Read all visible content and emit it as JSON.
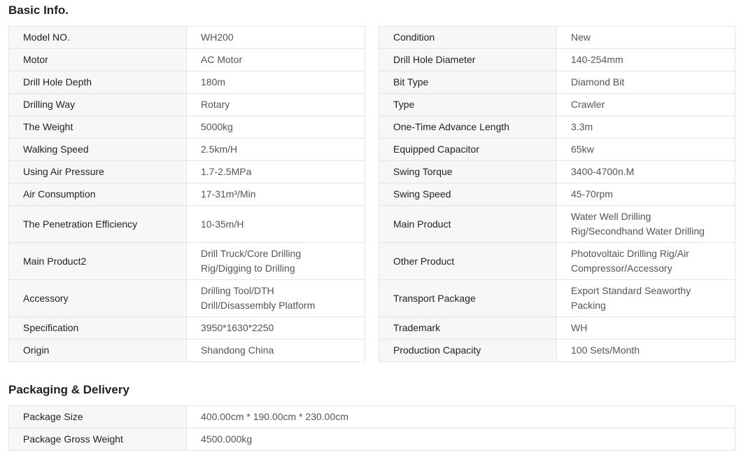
{
  "basic_info": {
    "title": "Basic Info.",
    "left": [
      {
        "label": "Model NO.",
        "value": "WH200",
        "lines": 1
      },
      {
        "label": "Motor",
        "value": "AC Motor",
        "lines": 1
      },
      {
        "label": "Drill Hole Depth",
        "value": "180m",
        "lines": 1
      },
      {
        "label": "Drilling Way",
        "value": "Rotary",
        "lines": 1
      },
      {
        "label": "The Weight",
        "value": "5000kg",
        "lines": 1
      },
      {
        "label": "Walking Speed",
        "value": "2.5km/H",
        "lines": 1
      },
      {
        "label": "Using Air Pressure",
        "value": "1.7-2.5MPa",
        "lines": 1
      },
      {
        "label": "Air Consumption",
        "value": "17-31m³/Min",
        "lines": 1
      },
      {
        "label": "The Penetration Efficiency",
        "value": "10-35m/H",
        "lines": 2
      },
      {
        "label": "Main Product2",
        "value": [
          "Drill Truck/Core Drilling",
          "Rig/Digging to Drilling"
        ],
        "lines": 2
      },
      {
        "label": "Accessory",
        "value": [
          "Drilling Tool/DTH",
          "Drill/Disassembly Platform"
        ],
        "lines": 2
      },
      {
        "label": "Specification",
        "value": "3950*1630*2250",
        "lines": 1
      },
      {
        "label": "Origin",
        "value": "Shandong China",
        "lines": 1
      }
    ],
    "right": [
      {
        "label": "Condition",
        "value": "New",
        "lines": 1
      },
      {
        "label": "Drill Hole Diameter",
        "value": "140-254mm",
        "lines": 1
      },
      {
        "label": "Bit Type",
        "value": "Diamond Bit",
        "lines": 1
      },
      {
        "label": "Type",
        "value": "Crawler",
        "lines": 1
      },
      {
        "label": "One-Time Advance Length",
        "value": "3.3m",
        "lines": 1
      },
      {
        "label": "Equipped Capacitor",
        "value": "65kw",
        "lines": 1
      },
      {
        "label": "Swing Torque",
        "value": "3400-4700n.M",
        "lines": 1
      },
      {
        "label": "Swing Speed",
        "value": "45-70rpm",
        "lines": 1
      },
      {
        "label": "Main Product",
        "value": [
          "Water Well Drilling",
          "Rig/Secondhand Water Drilling"
        ],
        "lines": 2
      },
      {
        "label": "Other Product",
        "value": [
          "Photovoltaic Drilling Rig/Air",
          "Compressor/Accessory"
        ],
        "lines": 2
      },
      {
        "label": "Transport Package",
        "value": [
          "Export Standard Seaworthy",
          "Packing"
        ],
        "lines": 2
      },
      {
        "label": "Trademark",
        "value": "WH",
        "lines": 1
      },
      {
        "label": "Production Capacity",
        "value": "100 Sets/Month",
        "lines": 1
      }
    ]
  },
  "packaging": {
    "title": "Packaging & Delivery",
    "rows": [
      {
        "label": "Package Size",
        "value": "400.00cm * 190.00cm * 230.00cm",
        "lines": 1
      },
      {
        "label": "Package Gross Weight",
        "value": "4500.000kg",
        "lines": 1
      }
    ]
  },
  "colors": {
    "label_bg": "#f7f7f7",
    "border": "#e4e4e4",
    "label_text": "#222222",
    "value_text": "#555555"
  }
}
